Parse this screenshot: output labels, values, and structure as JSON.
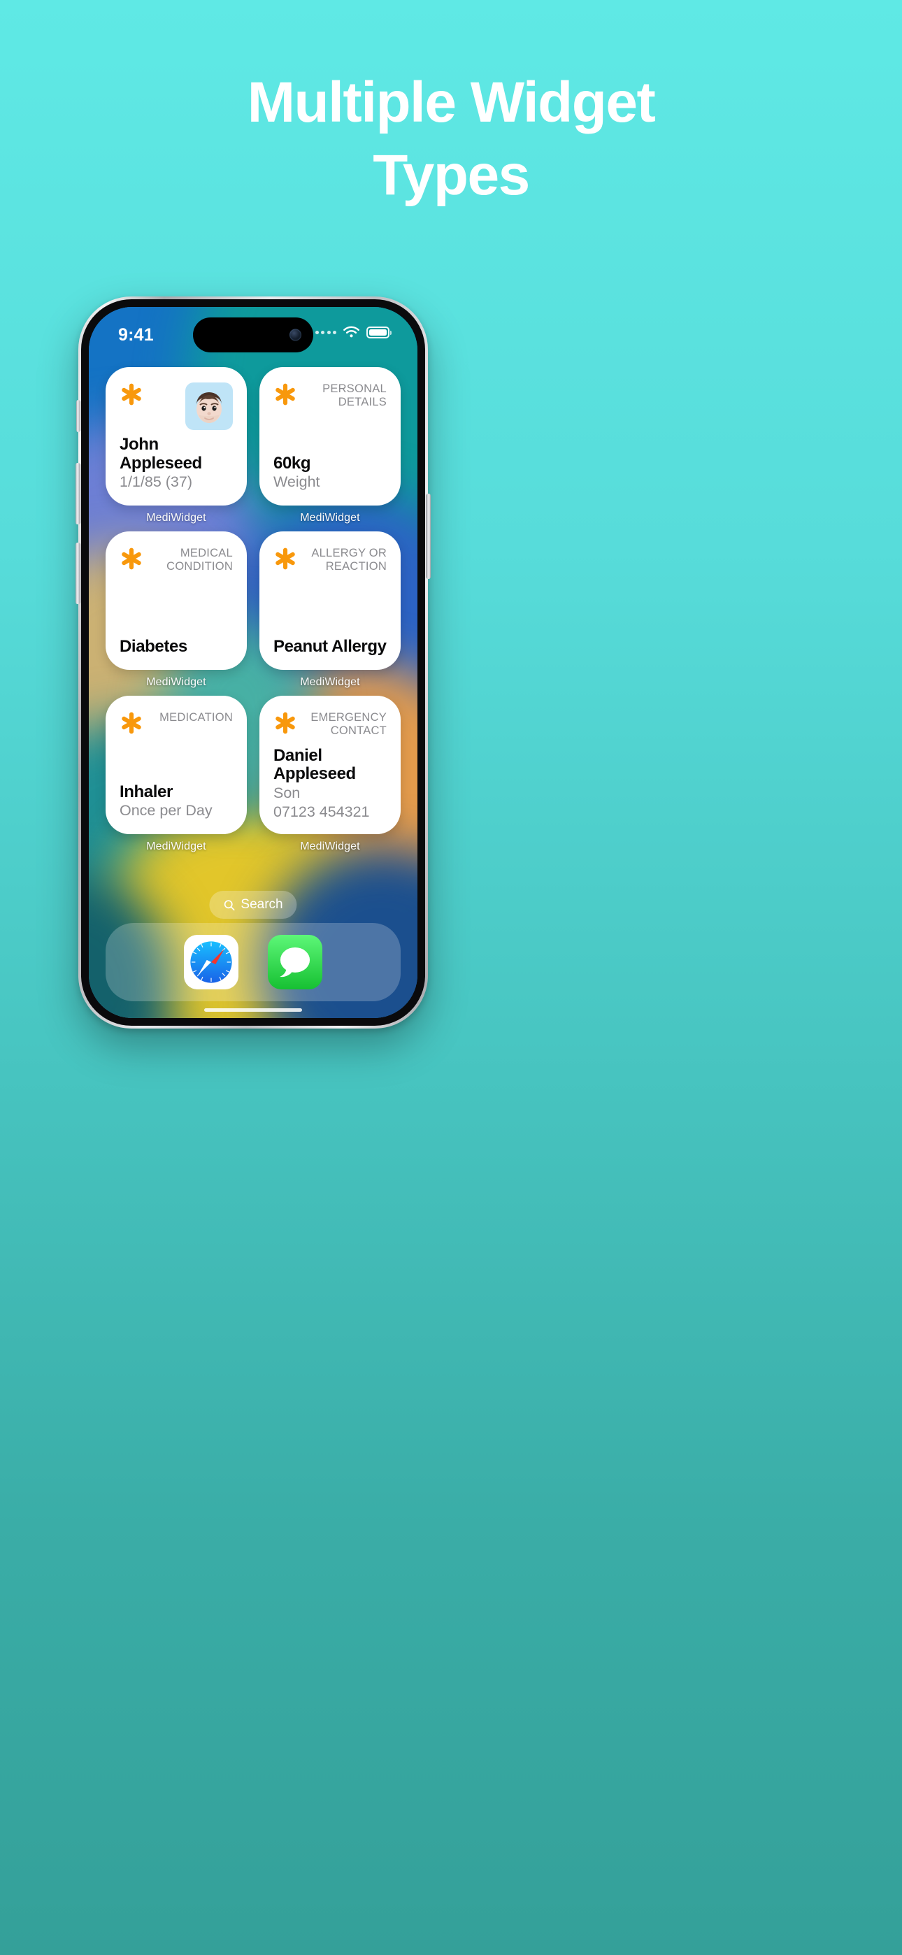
{
  "headline": {
    "line1": "Multiple Widget",
    "line2": "Types"
  },
  "colors": {
    "bg_top": "#5FE9E5",
    "bg_bottom": "#34A099",
    "accent_orange": "#F8980C",
    "widget_bg": "#FFFFFF",
    "category_text": "#8B8B8F",
    "title_text": "#0B0B0C"
  },
  "phone": {
    "status_bar": {
      "time": "9:41",
      "cellular_icon": "cellular-dots-icon",
      "wifi_icon": "wifi-icon",
      "battery_icon": "battery-full-icon",
      "dynamic_island": "dynamic-island",
      "camera_icon": "front-camera-icon"
    },
    "widgets": [
      {
        "id": "personal-profile",
        "icon": "asterisk-icon",
        "category": "",
        "avatar": "memoji-avatar",
        "title": "John Appleseed",
        "subtitle": "1/1/85 (37)",
        "app_label": "MediWidget",
        "layout": "avatar"
      },
      {
        "id": "personal-details",
        "icon": "asterisk-icon",
        "category": "PERSONAL DETAILS",
        "title": "60kg",
        "subtitle": "Weight",
        "app_label": "MediWidget",
        "layout": "bottom"
      },
      {
        "id": "medical-condition",
        "icon": "asterisk-icon",
        "category": "MEDICAL CONDITION",
        "title": "Diabetes",
        "subtitle": "",
        "app_label": "MediWidget",
        "layout": "bottom"
      },
      {
        "id": "allergy-or-reaction",
        "icon": "asterisk-icon",
        "category": "ALLERGY OR REACTION",
        "title": "Peanut Allergy",
        "subtitle": "",
        "app_label": "MediWidget",
        "layout": "bottom"
      },
      {
        "id": "medication",
        "icon": "asterisk-icon",
        "category": "MEDICATION",
        "title": "Inhaler",
        "subtitle": "Once per Day",
        "app_label": "MediWidget",
        "layout": "bottom"
      },
      {
        "id": "emergency-contact",
        "icon": "asterisk-icon",
        "category": "EMERGENCY CONTACT",
        "title": "Daniel Appleseed",
        "subtitle": "Son",
        "subtitle2": "07123 454321",
        "app_label": "MediWidget",
        "layout": "top"
      }
    ],
    "search": {
      "label": "Search",
      "icon": "search-icon"
    },
    "dock": {
      "apps": [
        {
          "name": "Safari",
          "icon": "safari-icon"
        },
        {
          "name": "Messages",
          "icon": "messages-icon"
        }
      ]
    },
    "hardware": {
      "silent_switch": "silent-switch",
      "volume_up": "volume-up-button",
      "volume_down": "volume-down-button",
      "power": "power-button"
    }
  }
}
